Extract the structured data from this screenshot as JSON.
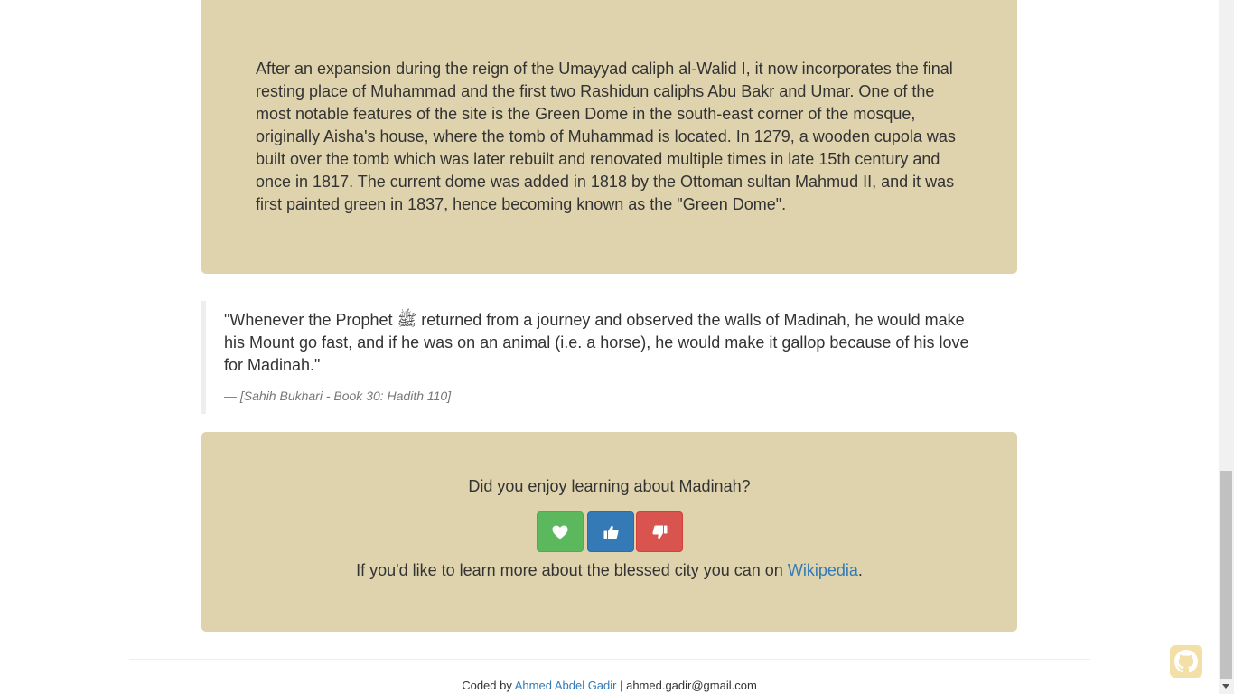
{
  "history": {
    "paragraph": "After an expansion during the reign of the Umayyad caliph al-Walid I, it now incorporates the final resting place of Muhammad and the first two Rashidun caliphs Abu Bakr and Umar. One of the most notable features of the site is the Green Dome in the south-east corner of the mosque, originally Aisha's house, where the tomb of Muhammad is located. In 1279, a wooden cupola was built over the tomb which was later rebuilt and renovated multiple times in late 15th century and once in 1817. The current dome was added in 1818 by the Ottoman sultan Mahmud II, and it was first painted green in 1837, hence becoming known as the \"Green Dome\"."
  },
  "quote": {
    "text": "\"Whenever the Prophet ﷺ returned from a journey and observed the walls of Madinah, he would make his Mount go fast, and if he was on an animal (i.e. a horse), he would make it gallop because of his love for Madinah.\"",
    "citation": "— [Sahih Bukhari - Book 30: Hadith 110]"
  },
  "feedback": {
    "question": "Did you enjoy learning about Madinah?",
    "buttons": [
      {
        "icon": "heart-icon",
        "color": "#5cb85c"
      },
      {
        "icon": "thumbs-up-icon",
        "color": "#337ab7"
      },
      {
        "icon": "thumbs-down-icon",
        "color": "#d9534f"
      }
    ],
    "more_prefix": "If you'd like to learn more about the blessed city you can on ",
    "more_link": "Wikipedia",
    "more_suffix": "."
  },
  "footer": {
    "coded_by": "Coded by ",
    "author": "Ahmed Abdel Gadir",
    "separator": " | ",
    "email": "ahmed.gadir@gmail.com"
  },
  "colors": {
    "panel": "#dfd3ae",
    "link": "#337ab7",
    "github_icon": "#f3dfa8"
  }
}
